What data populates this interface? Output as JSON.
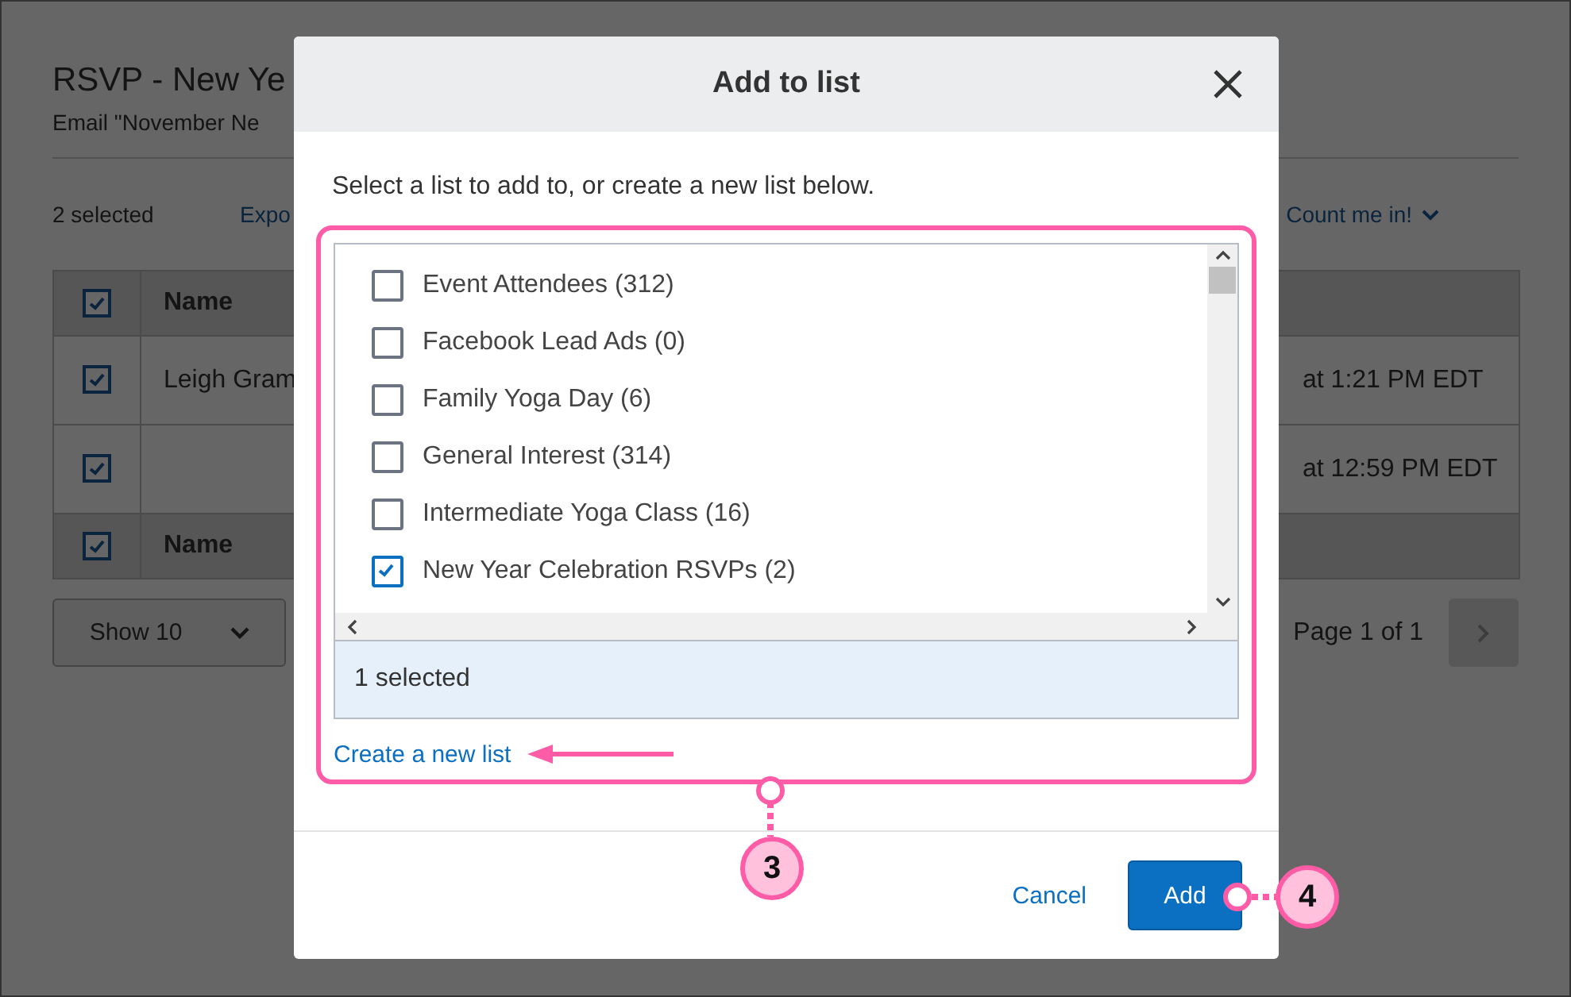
{
  "page": {
    "title": "RSVP - New Ye",
    "subtitle": "Email \"November Ne",
    "selection_count": "2 selected",
    "export_link": "Expo",
    "list_filter": "Count me in!",
    "table": {
      "header": {
        "checked": true,
        "label": "Name"
      },
      "rows": [
        {
          "checked": true,
          "name": "Leigh Gram",
          "date": "at 1:21 PM EDT"
        },
        {
          "checked": true,
          "date": "at 12:59 PM EDT"
        }
      ],
      "footer": {
        "checked": true,
        "label": "Name"
      }
    },
    "page_size": "Show 10",
    "pagination": "Page 1 of 1"
  },
  "dialog": {
    "title": "Add to list",
    "instruction": "Select a list to add to, or create a new list below.",
    "lists": [
      {
        "label": "Event Attendees (312)",
        "checked": false
      },
      {
        "label": "Facebook Lead Ads (0)",
        "checked": false
      },
      {
        "label": "Family Yoga Day (6)",
        "checked": false
      },
      {
        "label": "General Interest (314)",
        "checked": false
      },
      {
        "label": "Intermediate Yoga Class (16)",
        "checked": false
      },
      {
        "label": "New Year Celebration RSVPs (2)",
        "checked": true
      }
    ],
    "selected_summary": "1 selected",
    "create_link": "Create a new list",
    "cancel": "Cancel",
    "add": "Add"
  },
  "callouts": [
    {
      "label": "3"
    },
    {
      "label": "4"
    }
  ]
}
